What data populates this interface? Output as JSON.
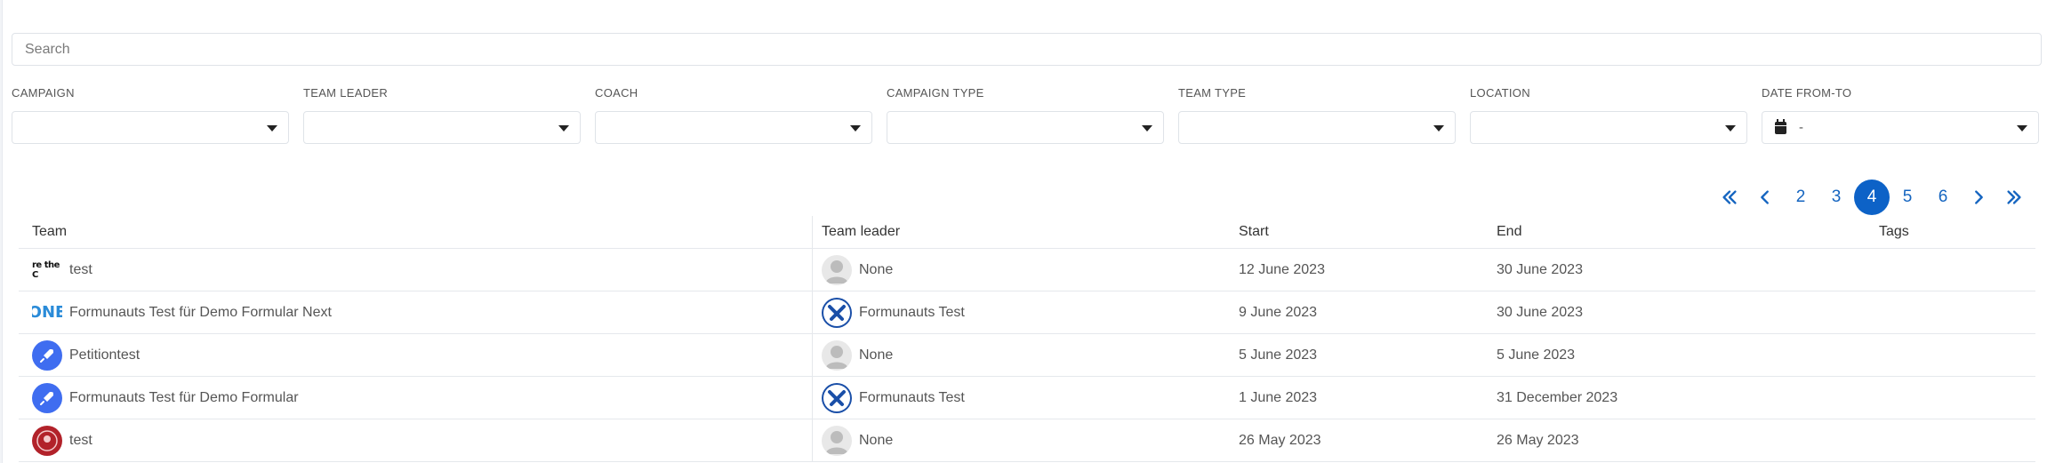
{
  "search": {
    "placeholder": "Search"
  },
  "filters": [
    {
      "label": "CAMPAIGN",
      "value": ""
    },
    {
      "label": "TEAM LEADER",
      "value": ""
    },
    {
      "label": "COACH",
      "value": ""
    },
    {
      "label": "CAMPAIGN TYPE",
      "value": ""
    },
    {
      "label": "TEAM TYPE",
      "value": ""
    },
    {
      "label": "LOCATION",
      "value": ""
    },
    {
      "label": "DATE FROM-TO",
      "value": "-"
    }
  ],
  "pagination": {
    "pages": [
      "2",
      "3",
      "4",
      "5",
      "6"
    ],
    "current": "4"
  },
  "table": {
    "columns": [
      "Team",
      "Team leader",
      "Start",
      "End",
      "Tags"
    ],
    "rows": [
      {
        "team": "test",
        "team_icon_text": "re the C",
        "leader": "None",
        "start": "12 June 2023",
        "end": "30 June 2023",
        "tags": ""
      },
      {
        "team": "Formunauts Test für Demo Formular Next",
        "team_icon_text": "ONE",
        "leader": "Formunauts Test",
        "start": "9 June 2023",
        "end": "30 June 2023",
        "tags": ""
      },
      {
        "team": "Petitiontest",
        "leader": "None",
        "start": "5 June 2023",
        "end": "5 June 2023",
        "tags": ""
      },
      {
        "team": "Formunauts Test für Demo Formular",
        "leader": "Formunauts Test",
        "start": "1 June 2023",
        "end": "31 December 2023",
        "tags": ""
      },
      {
        "team": "test",
        "leader": "None",
        "start": "26 May 2023",
        "end": "26 May 2023",
        "tags": ""
      }
    ]
  },
  "colors": {
    "accent": "#0d62c7",
    "link": "#1565c0",
    "border": "#dfe3e8"
  }
}
